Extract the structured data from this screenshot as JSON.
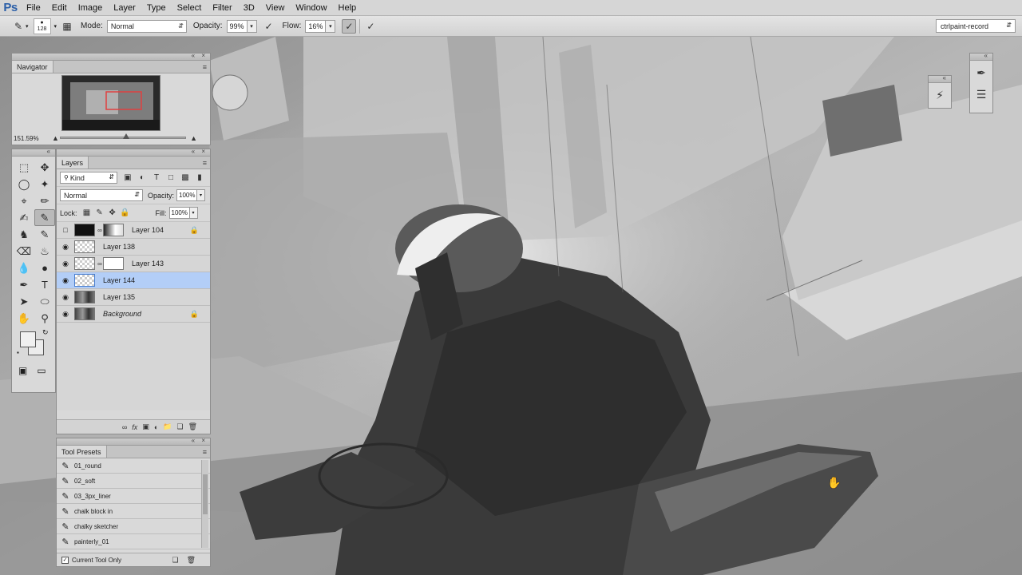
{
  "app": {
    "logo": "Ps"
  },
  "menu": [
    "File",
    "Edit",
    "Image",
    "Layer",
    "Type",
    "Select",
    "Filter",
    "3D",
    "View",
    "Window",
    "Help"
  ],
  "options": {
    "brush_size": "128",
    "mode_label": "Mode:",
    "mode_value": "Normal",
    "opacity_label": "Opacity:",
    "opacity_value": "99%",
    "flow_label": "Flow:",
    "flow_value": "16%",
    "workspace": "ctrlpaint-record"
  },
  "navigator": {
    "tab": "Navigator",
    "zoom": "151.59%"
  },
  "layers": {
    "tab": "Layers",
    "kind": "Kind",
    "blend_mode": "Normal",
    "opacity_label": "Opacity:",
    "opacity_value": "100%",
    "lock_label": "Lock:",
    "fill_label": "Fill:",
    "fill_value": "100%",
    "items": [
      {
        "name": "Layer 104",
        "visible": false,
        "locked": true,
        "selected": false
      },
      {
        "name": "Layer 138",
        "visible": true,
        "locked": false,
        "selected": false
      },
      {
        "name": "Layer 143",
        "visible": true,
        "locked": false,
        "selected": false
      },
      {
        "name": "Layer 144",
        "visible": true,
        "locked": false,
        "selected": true
      },
      {
        "name": "Layer 135",
        "visible": true,
        "locked": false,
        "selected": false
      },
      {
        "name": "Background",
        "visible": true,
        "locked": true,
        "selected": false
      }
    ]
  },
  "presets": {
    "tab": "Tool Presets",
    "items": [
      "01_round",
      "02_soft",
      "03_3px_liner",
      "chalk block in",
      "chalky sketcher",
      "painterly_01"
    ],
    "current_only_label": "Current Tool Only"
  },
  "colors": {
    "foreground": "#f0f0f0",
    "background": "#ececec",
    "selection": "#b3cef7"
  }
}
